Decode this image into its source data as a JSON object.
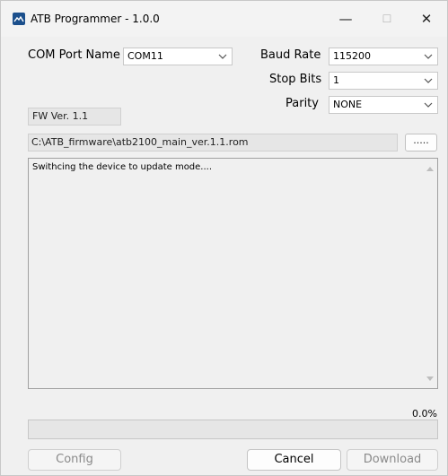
{
  "window": {
    "title": "ATB Programmer - 1.0.0",
    "minimize_glyph": "—",
    "maximize_glyph": "☐",
    "close_glyph": "✕"
  },
  "settings": {
    "com_port_label": "COM Port Name",
    "com_port_value": "COM11",
    "baud_rate_label": "Baud Rate",
    "baud_rate_value": "115200",
    "stop_bits_label": "Stop Bits",
    "stop_bits_value": "1",
    "parity_label": "Parity",
    "parity_value": "NONE"
  },
  "firmware": {
    "version": "FW Ver. 1.1",
    "path": "C:\\ATB_firmware\\atb2100_main_ver.1.1.rom",
    "browse_label": "....."
  },
  "log": {
    "text": "Swithcing the device to update mode...."
  },
  "progress": {
    "percent_label": "0.0%",
    "value": 0.0
  },
  "buttons": {
    "config": "Config",
    "cancel": "Cancel",
    "download": "Download"
  },
  "colors": {
    "app_icon": "#1b4f8c",
    "progress_fill": "#06b025"
  },
  "icons": {
    "app": "app-logo-icon",
    "dropdown": "chevron-down-icon",
    "scroll_up": "scroll-up-arrow-icon",
    "scroll_down": "scroll-down-arrow-icon"
  }
}
